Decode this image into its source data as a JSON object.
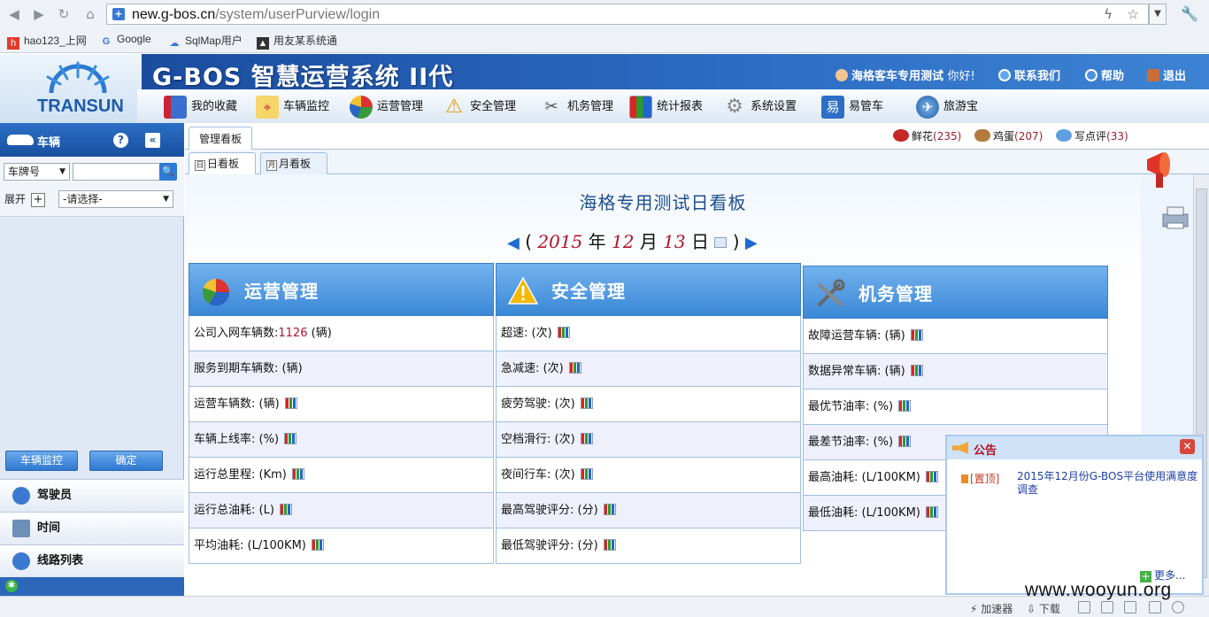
{
  "browser": {
    "url_host": "new.g-bos.cn",
    "url_path": "/system/userPurview/login",
    "bookmarks": [
      {
        "label": "hao123_上网",
        "icon": "hao123-icon"
      },
      {
        "label": "Google",
        "icon": "google-icon"
      },
      {
        "label": "SqlMap用户",
        "icon": "cloud-icon"
      },
      {
        "label": "用友某系统通",
        "icon": "site-icon"
      }
    ]
  },
  "header": {
    "logo_text": "TRANSUN",
    "title": "G-BOS 智慧运营系统 II代",
    "user": "海格客车专用测试",
    "greeting": "你好!",
    "contact": "联系我们",
    "help": "帮助",
    "logout": "退出"
  },
  "menu": [
    {
      "label": "我的收藏",
      "icon": "favorites-icon"
    },
    {
      "label": "车辆监控",
      "icon": "vehicle-monitor-icon"
    },
    {
      "label": "运营管理",
      "icon": "pie-chart-icon"
    },
    {
      "label": "安全管理",
      "icon": "warning-icon"
    },
    {
      "label": "机务管理",
      "icon": "tools-icon"
    },
    {
      "label": "统计报表",
      "icon": "report-icon"
    },
    {
      "label": "系统设置",
      "icon": "gear-icon"
    },
    {
      "label": "易管车",
      "icon": "yi-icon"
    },
    {
      "label": "旅游宝",
      "icon": "globe-icon"
    }
  ],
  "sidebar": {
    "title": "车辆",
    "search_type": "车牌号",
    "expand_label": "展开",
    "select_placeholder": "-请选择-",
    "monitor_button": "车辆监控",
    "confirm_button": "确定",
    "sections": [
      "驾驶员",
      "时间",
      "线路列表"
    ]
  },
  "tabs": {
    "main_tab": "管理看板",
    "sub_tabs": [
      "日看板",
      "月看板"
    ],
    "day_icon": "日",
    "month_icon": "月"
  },
  "rewards": [
    {
      "label": "鲜花",
      "count": "(235)"
    },
    {
      "label": "鸡蛋",
      "count": "(207)"
    },
    {
      "label": "写点评",
      "count": "(33)"
    }
  ],
  "board": {
    "title": "海格专用测试日看板",
    "date": {
      "open": "(",
      "year": "2015",
      "year_unit": "年",
      "month": "12",
      "month_unit": "月",
      "day": "13",
      "day_unit": "日",
      "close": ")"
    }
  },
  "panels": [
    {
      "title": "运营管理",
      "rows": [
        {
          "label": "公司入网车辆数:",
          "value": "1126",
          "unit": "(辆)",
          "chart": false
        },
        {
          "label": "服务到期车辆数:",
          "value": "",
          "unit": "(辆)",
          "chart": false
        },
        {
          "label": "运营车辆数:",
          "value": "",
          "unit": "(辆)",
          "chart": true
        },
        {
          "label": "车辆上线率:",
          "value": "",
          "unit": "(%)",
          "chart": true
        },
        {
          "label": "运行总里程:",
          "value": "",
          "unit": "(Km)",
          "chart": true
        },
        {
          "label": "运行总油耗:",
          "value": "",
          "unit": "(L)",
          "chart": true
        },
        {
          "label": "平均油耗:",
          "value": "",
          "unit": "(L/100KM)",
          "chart": true
        }
      ]
    },
    {
      "title": "安全管理",
      "rows": [
        {
          "label": "超速:",
          "value": "",
          "unit": "(次)",
          "chart": true
        },
        {
          "label": "急减速:",
          "value": "",
          "unit": "(次)",
          "chart": true
        },
        {
          "label": "疲劳驾驶:",
          "value": "",
          "unit": "(次)",
          "chart": true
        },
        {
          "label": "空档滑行:",
          "value": "",
          "unit": "(次)",
          "chart": true
        },
        {
          "label": "夜间行车:",
          "value": "",
          "unit": "(次)",
          "chart": true
        },
        {
          "label": "最高驾驶评分:",
          "value": "",
          "unit": "(分)",
          "chart": true
        },
        {
          "label": "最低驾驶评分:",
          "value": "",
          "unit": "(分)",
          "chart": true
        }
      ]
    },
    {
      "title": "机务管理",
      "rows": [
        {
          "label": "故障运营车辆:",
          "value": "",
          "unit": "(辆)",
          "chart": true
        },
        {
          "label": "数据异常车辆:",
          "value": "",
          "unit": "(辆)",
          "chart": true
        },
        {
          "label": "最优节油率:",
          "value": "",
          "unit": "(%)",
          "chart": true
        },
        {
          "label": "最差节油率:",
          "value": "",
          "unit": "(%)",
          "chart": true
        },
        {
          "label": "最高油耗:",
          "value": "",
          "unit": "(L/100KM)",
          "chart": true
        },
        {
          "label": "最低油耗:",
          "value": "",
          "unit": "(L/100KM)",
          "chart": true
        }
      ]
    }
  ],
  "notice": {
    "title": "公告",
    "tag": "[置顶]",
    "text": "2015年12月份G-BOS平台使用满意度调查",
    "more": "更多..."
  },
  "statusbar": {
    "accelerator": "加速器",
    "download": "下载",
    "watermark": "www.wooyun.org"
  },
  "colors": {
    "header_blue": "#1b4c9e",
    "panel_blue": "#3a88d6",
    "value_red": "#b3122a"
  }
}
